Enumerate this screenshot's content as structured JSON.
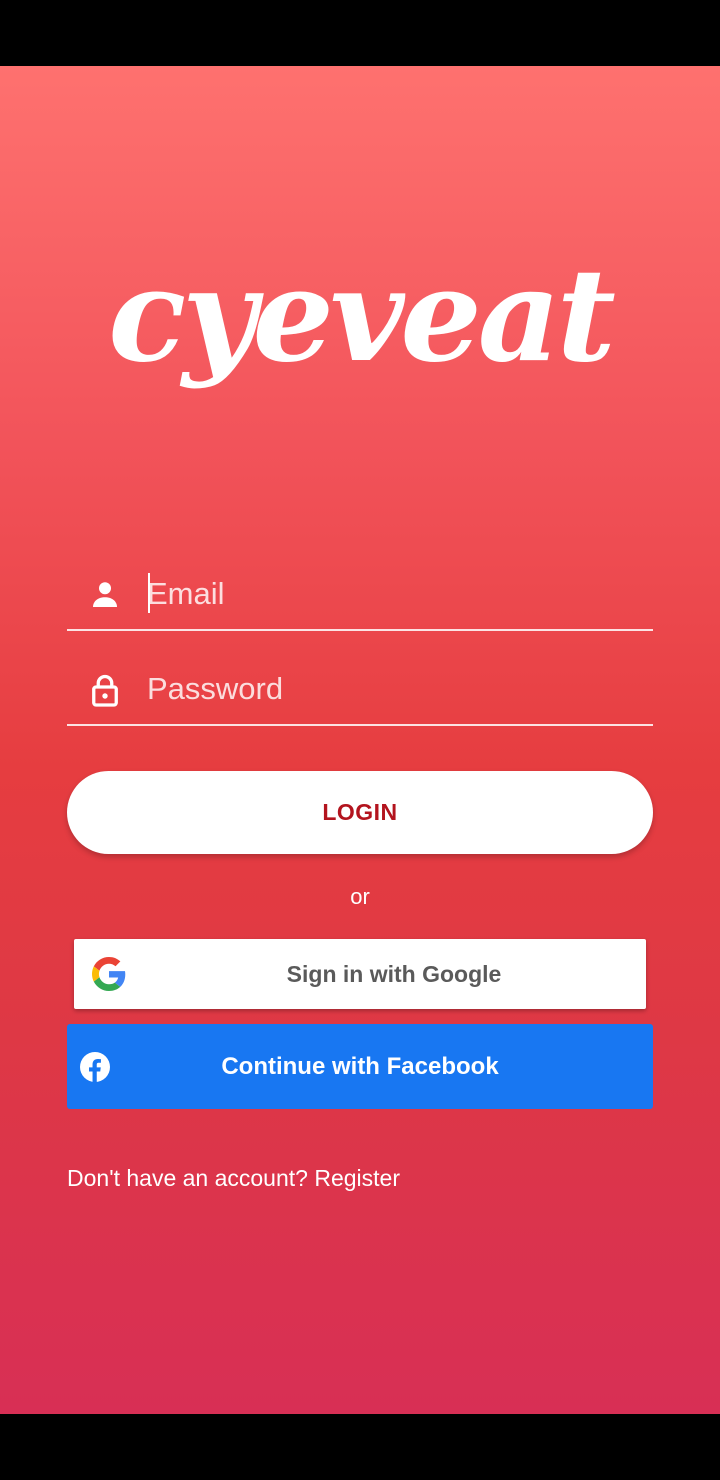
{
  "app": {
    "logo_text": "cyeveat"
  },
  "login_form": {
    "email": {
      "placeholder": "Email",
      "value": ""
    },
    "password": {
      "placeholder": "Password",
      "value": ""
    },
    "login_label": "LOGIN",
    "or_text": "or"
  },
  "social": {
    "google_label": "Sign in with Google",
    "facebook_label": "Continue with Facebook"
  },
  "register": {
    "prompt": "Don't have an account?",
    "link_label": "Register"
  },
  "colors": {
    "gradient_top": "#fe716f",
    "gradient_bottom": "#d82f55",
    "login_text": "#b3141e",
    "facebook_blue": "#1877f2",
    "google_text": "#5a5a5a"
  },
  "icons": {
    "email": "person-icon",
    "password": "lock-icon",
    "google": "google-g-icon",
    "facebook": "facebook-f-icon"
  }
}
